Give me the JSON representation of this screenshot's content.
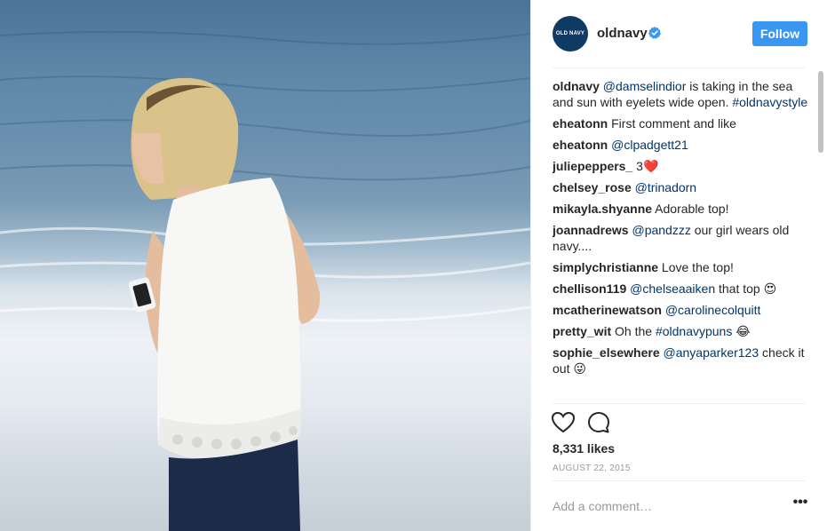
{
  "post": {
    "image_alt": "Woman in white eyelet top on beach"
  },
  "header": {
    "avatar_text": "OLD NAVY",
    "username": "oldnavy",
    "follow_label": "Follow"
  },
  "comments": [
    {
      "user": "oldnavy",
      "segments": [
        {
          "t": " "
        },
        {
          "t": "@damselindior",
          "link": true
        },
        {
          "t": " is taking in the sea and sun with eyelets wide open. "
        },
        {
          "t": "#oldnavystyle",
          "link": true
        }
      ]
    },
    {
      "user": "eheatonn",
      "segments": [
        {
          "t": " First comment and like"
        }
      ]
    },
    {
      "user": "eheatonn",
      "segments": [
        {
          "t": " "
        },
        {
          "t": "@clpadgett21",
          "link": true
        }
      ]
    },
    {
      "user": "juliepeppers_",
      "segments": [
        {
          "t": " 3❤️"
        }
      ]
    },
    {
      "user": "chelsey_rose",
      "segments": [
        {
          "t": " "
        },
        {
          "t": "@trinadorn",
          "link": true
        }
      ]
    },
    {
      "user": "mikayla.shyanne",
      "segments": [
        {
          "t": " Adorable top!"
        }
      ]
    },
    {
      "user": "joannadrews",
      "segments": [
        {
          "t": " "
        },
        {
          "t": "@pandzzz",
          "link": true
        },
        {
          "t": " our girl wears old navy...."
        }
      ]
    },
    {
      "user": "simplychristianne",
      "segments": [
        {
          "t": " Love the top!"
        }
      ]
    },
    {
      "user": "chellison119",
      "segments": [
        {
          "t": " "
        },
        {
          "t": "@chelseaaiken",
          "link": true
        },
        {
          "t": " that top 😍"
        }
      ]
    },
    {
      "user": "mcatherinewatson",
      "segments": [
        {
          "t": " "
        },
        {
          "t": "@carolinecolquitt",
          "link": true
        }
      ]
    },
    {
      "user": "pretty_wit",
      "segments": [
        {
          "t": " Oh the "
        },
        {
          "t": "#oldnavypuns",
          "link": true
        },
        {
          "t": " 😂"
        }
      ]
    },
    {
      "user": "sophie_elsewhere",
      "segments": [
        {
          "t": " "
        },
        {
          "t": "@anyaparker123",
          "link": true
        },
        {
          "t": " check it out 😜"
        }
      ]
    }
  ],
  "actions": {
    "like_icon": "heart-icon",
    "comment_icon": "comment-bubble-icon"
  },
  "likes_label": "8,331 likes",
  "date_label": "AUGUST 22, 2015",
  "comment_input": {
    "placeholder": "Add a comment…"
  },
  "more_label": "•••",
  "colors": {
    "follow_button": "#3897f0",
    "link": "#003569",
    "verified": "#3897f0",
    "avatar_bg": "#0f3a64"
  }
}
